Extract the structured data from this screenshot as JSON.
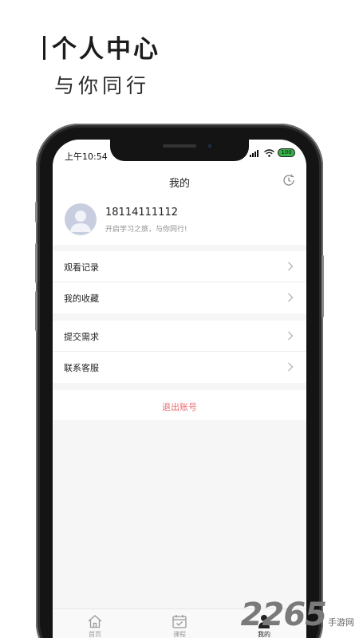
{
  "promo": {
    "title": "个人中心",
    "subtitle": "与你同行"
  },
  "status_bar": {
    "time": "上午10:54",
    "battery": "100"
  },
  "nav": {
    "title": "我的",
    "history_icon": "history-icon"
  },
  "profile": {
    "phone": "18114111112",
    "motto": "开启学习之旅，与你同行!"
  },
  "menu": {
    "group1": [
      {
        "label": "观看记录"
      },
      {
        "label": "我的收藏"
      }
    ],
    "group2": [
      {
        "label": "提交需求"
      },
      {
        "label": "联系客服"
      }
    ]
  },
  "logout": {
    "label": "退出账号"
  },
  "tabs": [
    {
      "label": "首页",
      "icon": "home-icon",
      "active": false
    },
    {
      "label": "课程",
      "icon": "calendar-check-icon",
      "active": false
    },
    {
      "label": "我的",
      "icon": "person-icon",
      "active": true
    }
  ],
  "watermark": {
    "number": "2265",
    "text": "手游网"
  },
  "colors": {
    "logout_text": "#e86a6f",
    "screen_bg": "#f6f6f6",
    "avatar_bg": "#c9cde0"
  }
}
